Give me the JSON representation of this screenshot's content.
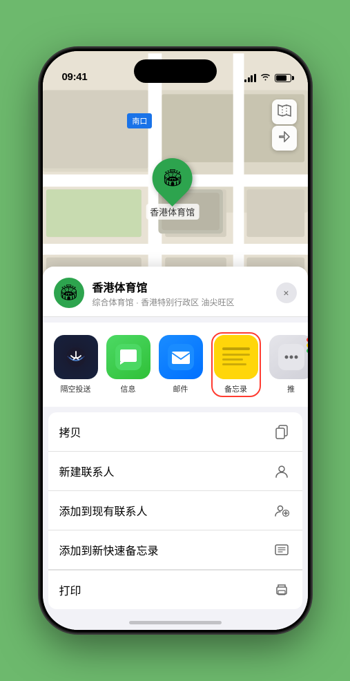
{
  "status_bar": {
    "time": "09:41",
    "location_arrow": "▶"
  },
  "map": {
    "label": "南口"
  },
  "location": {
    "name": "香港体育馆",
    "description": "综合体育馆 · 香港特别行政区 油尖旺区"
  },
  "apps": [
    {
      "id": "airdrop",
      "label": "隔空投送",
      "icon": "📡"
    },
    {
      "id": "messages",
      "label": "信息",
      "icon": "💬"
    },
    {
      "id": "mail",
      "label": "邮件",
      "icon": "✉️"
    },
    {
      "id": "notes",
      "label": "备忘录",
      "icon": "📝"
    },
    {
      "id": "more",
      "label": "推",
      "icon": "···"
    }
  ],
  "actions": [
    {
      "id": "copy",
      "label": "拷贝",
      "icon": "⊡"
    },
    {
      "id": "new-contact",
      "label": "新建联系人",
      "icon": "👤"
    },
    {
      "id": "add-to-contact",
      "label": "添加到现有联系人",
      "icon": "👤+"
    },
    {
      "id": "quick-note",
      "label": "添加到新快速备忘录",
      "icon": "📋"
    },
    {
      "id": "print",
      "label": "打印",
      "icon": "🖨️"
    }
  ],
  "buttons": {
    "close": "×",
    "map_type": "🗺",
    "location_arrow": "◎"
  },
  "colors": {
    "green": "#2da44e",
    "highlight_red": "#ff3b30",
    "notes_yellow": "#ffd60a"
  }
}
